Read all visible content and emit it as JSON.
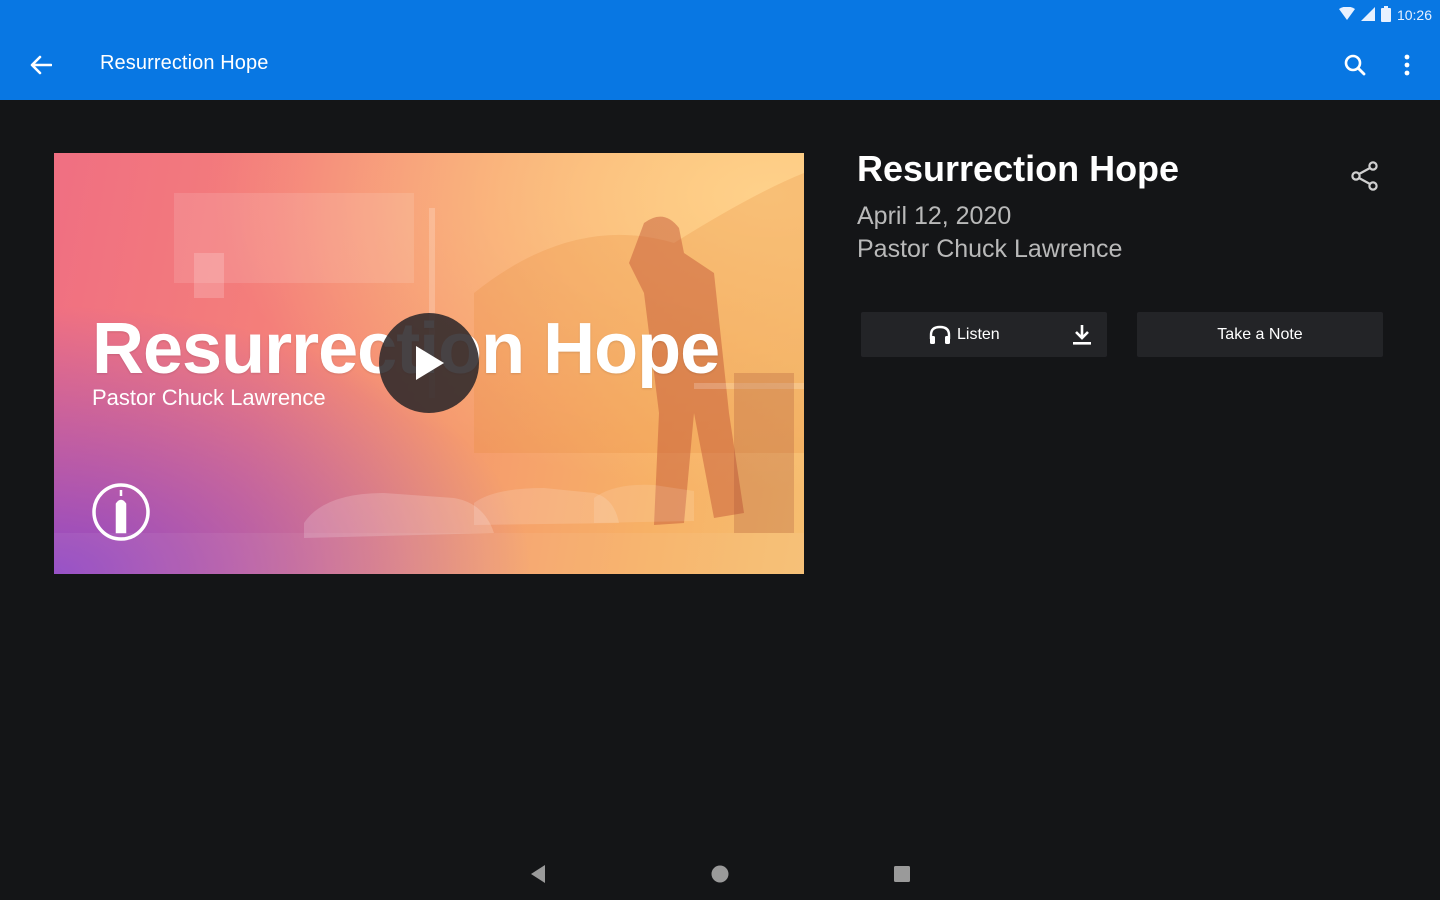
{
  "status_bar": {
    "time": "10:26",
    "icons": [
      "wifi-icon",
      "signal-icon",
      "battery-icon"
    ]
  },
  "app_bar": {
    "title": "Resurrection Hope",
    "color": "#0877e3",
    "icons": [
      "back-arrow-icon",
      "search-icon",
      "more-vertical-icon"
    ]
  },
  "video": {
    "overlay_title": "Resurrection Hope",
    "overlay_subtitle": "Pastor Chuck Lawrence",
    "play_icon": "play-icon",
    "logo_icon": "church-logo-icon"
  },
  "sermon": {
    "title": "Resurrection Hope",
    "date": "April 12, 2020",
    "speaker": "Pastor Chuck Lawrence",
    "share_icon": "share-icon"
  },
  "actions": {
    "listen_label": "Listen",
    "listen_icon": "headphones-icon",
    "download_icon": "download-icon",
    "note_label": "Take a Note"
  },
  "nav_bar": {
    "icons": [
      "nav-back-icon",
      "nav-home-icon",
      "nav-recents-icon"
    ]
  }
}
